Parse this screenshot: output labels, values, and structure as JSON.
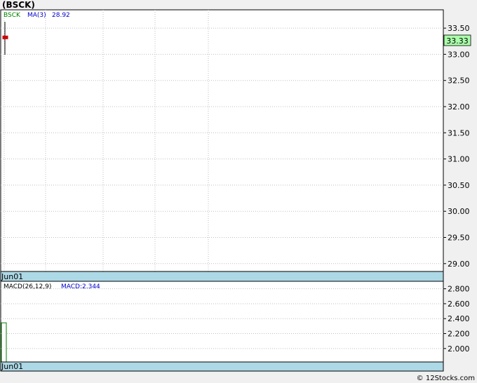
{
  "title": "(BSCK)",
  "footer": "© 12Stocks.com",
  "colors": {
    "up": "#008000",
    "down": "#cc0000",
    "ma": "#0000cc",
    "date_bar": "#add8e6",
    "price_tag": "#aaffaa",
    "grid": "#bfbfbf"
  },
  "chart_data": [
    {
      "type": "candlestick",
      "symbol": "BSCK",
      "ma_label": "MA(3)",
      "ma_value": "28.92",
      "last_price": "33.33",
      "ylim": [
        28.85,
        33.85
      ],
      "ticks": [
        {
          "value": 33.5,
          "label": "33.50"
        },
        {
          "value": 33.0,
          "label": "33.00"
        },
        {
          "value": 32.5,
          "label": "32.50"
        },
        {
          "value": 32.0,
          "label": "32.00"
        },
        {
          "value": 31.5,
          "label": "31.50"
        },
        {
          "value": 31.0,
          "label": "31.00"
        },
        {
          "value": 30.5,
          "label": "30.50"
        },
        {
          "value": 30.0,
          "label": "30.00"
        },
        {
          "value": 29.5,
          "label": "29.50"
        },
        {
          "value": 29.0,
          "label": "29.00"
        }
      ],
      "date_label": "Jun01",
      "candles": [
        {
          "open": 33.35,
          "close": 33.3,
          "high": 33.62,
          "low": 32.99
        }
      ],
      "grid": true
    },
    {
      "type": "bar",
      "legend": "MACD(26,12,9)",
      "macd_label": "MACD:2.344",
      "ylim": [
        1.82,
        2.9
      ],
      "ticks": [
        {
          "value": 2.8,
          "label": "2.800"
        },
        {
          "value": 2.6,
          "label": "2.600"
        },
        {
          "value": 2.4,
          "label": "2.400"
        },
        {
          "value": 2.2,
          "label": "2.200"
        },
        {
          "value": 2.0,
          "label": "2.000"
        }
      ],
      "date_label": "Jun01",
      "values": [
        2.344
      ],
      "grid": true
    }
  ]
}
